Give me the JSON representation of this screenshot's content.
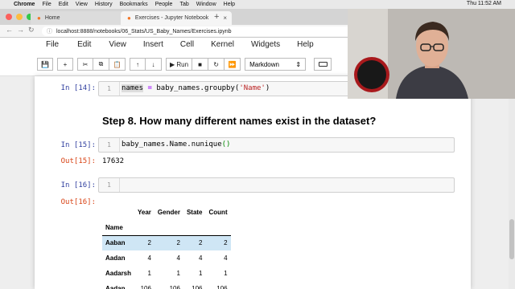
{
  "macos": {
    "app": "Chrome",
    "menus": [
      "File",
      "Edit",
      "View",
      "History",
      "Bookmarks",
      "People",
      "Tab",
      "Window",
      "Help"
    ],
    "clock": "Thu 11:52 AM"
  },
  "browser": {
    "tabs": [
      {
        "label": "Home",
        "active": false
      },
      {
        "label": "Exercises - Jupyter Notebook",
        "active": true
      }
    ],
    "new_tab": "+",
    "url": "localhost:8888/notebooks/06_Stats/US_Baby_Names/Exercises.ipynb"
  },
  "jupyter": {
    "menu": [
      "File",
      "Edit",
      "View",
      "Insert",
      "Cell",
      "Kernel",
      "Widgets",
      "Help"
    ],
    "toolbar": {
      "run_label": "Run",
      "cell_type": "Markdown"
    }
  },
  "notebook": {
    "cell14": {
      "prompt": "In [14]:",
      "line": "1",
      "code_var": "names",
      "code_op": "=",
      "code_call": "baby_names.groupby(",
      "code_str": "'Name'",
      "code_close": ")"
    },
    "heading": "Step 8. How many different names exist in the dataset?",
    "cell15": {
      "prompt": "In [15]:",
      "line": "1",
      "code": "baby_names.Name.nunique",
      "parens": "()"
    },
    "out15": {
      "prompt": "Out[15]:",
      "value": "17632"
    },
    "cell16": {
      "prompt": "In [16]:",
      "line": "1",
      "code": ""
    },
    "out16": {
      "prompt": "Out[16]:"
    },
    "table": {
      "columns": [
        "Year",
        "Gender",
        "State",
        "Count"
      ],
      "index_name": "Name",
      "rows": [
        {
          "name": "Aaban",
          "values": [
            "2",
            "2",
            "2",
            "2"
          ]
        },
        {
          "name": "Aadan",
          "values": [
            "4",
            "4",
            "4",
            "4"
          ]
        },
        {
          "name": "Aadarsh",
          "values": [
            "1",
            "1",
            "1",
            "1"
          ]
        },
        {
          "name": "Aadan",
          "values": [
            "106",
            "106",
            "106",
            "106"
          ]
        }
      ]
    }
  },
  "colors": {
    "in_prompt": "#303f9f",
    "out_prompt": "#d84315",
    "row_hover": "#cfe6f5",
    "jupyter_orange": "#f37626"
  }
}
